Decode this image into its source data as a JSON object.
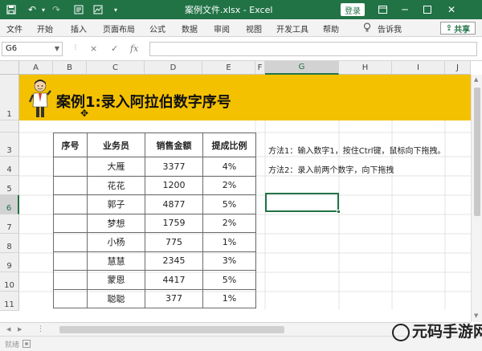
{
  "window": {
    "title": "案例文件.xlsx  -  Excel",
    "login_label": "登录"
  },
  "ribbon": {
    "tabs": [
      "文件",
      "开始",
      "插入",
      "页面布局",
      "公式",
      "数据",
      "审阅",
      "视图",
      "开发工具",
      "帮助"
    ],
    "tell_me": "告诉我",
    "share_label": "共享"
  },
  "formula_bar": {
    "name_box": "G6",
    "cancel_icon": "×",
    "enter_icon": "✓",
    "fx_icon": "fx",
    "content": ""
  },
  "grid": {
    "columns": [
      "A",
      "B",
      "C",
      "D",
      "E",
      "F",
      "G",
      "H",
      "I",
      "J"
    ],
    "rows": [
      "1",
      "3",
      "4",
      "5",
      "6",
      "7",
      "8",
      "9",
      "10",
      "11"
    ],
    "selected_column": "G",
    "selected_row": "6"
  },
  "banner": {
    "title": "案例1:录入阿拉伯数字序号"
  },
  "table": {
    "headers": [
      "序号",
      "业务员",
      "销售金额",
      "提成比例"
    ],
    "rows": [
      [
        "",
        "大雁",
        "3377",
        "4%"
      ],
      [
        "",
        "花花",
        "1200",
        "2%"
      ],
      [
        "",
        "郭子",
        "4877",
        "5%"
      ],
      [
        "",
        "梦想",
        "1759",
        "2%"
      ],
      [
        "",
        "小杨",
        "775",
        "1%"
      ],
      [
        "",
        "慧慧",
        "2345",
        "3%"
      ],
      [
        "",
        "蒙恩",
        "4417",
        "5%"
      ],
      [
        "",
        "聪聪",
        "377",
        "1%"
      ]
    ]
  },
  "notes": {
    "method1": "方法1：输入数字1，按住Ctrl键，鼠标向下拖拽。",
    "method2": "方法2：录入前两个数字，向下拖拽"
  },
  "status": {
    "ready": "就绪"
  },
  "watermark": {
    "text": "元码手游网"
  },
  "colors": {
    "excel_green": "#217346",
    "banner_yellow": "#f4c100"
  }
}
